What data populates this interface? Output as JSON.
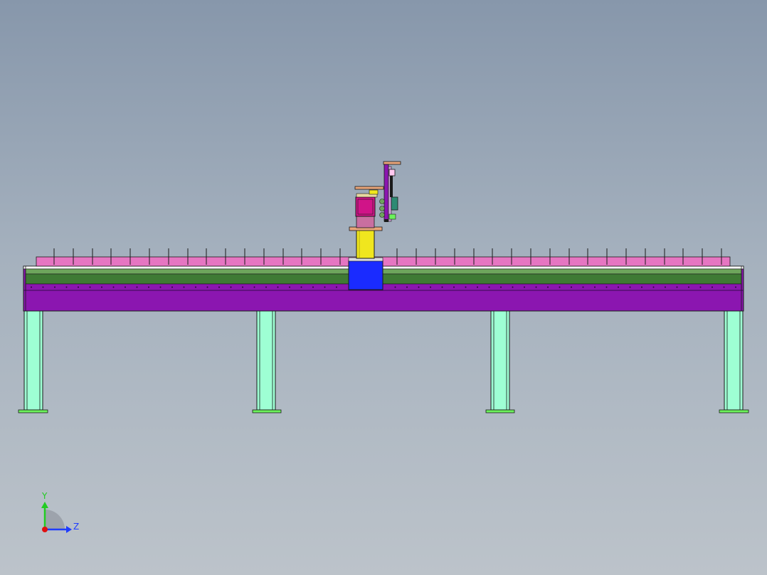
{
  "triad": {
    "y_label": "Y",
    "z_label": "Z",
    "colors": {
      "y_axis": "#22cc22",
      "z_axis": "#1e3cff",
      "x_axis": "#e01010"
    }
  },
  "model": {
    "colors": {
      "beam": "#8b16b0",
      "beam_dark": "#5a0a78",
      "rail": "#3f7a34",
      "rail_light": "#6ea55c",
      "rack": "#e676c2",
      "leg": "#9effd4",
      "foot": "#6cf25c",
      "carriage": "#1a2bff",
      "column": "#f0e61e",
      "motor_box": "#d01488",
      "arm_plate": "#e8a57a",
      "vertical_slide": "#8b16b0",
      "gripper": "#2e8b74"
    },
    "rack_tooth_count": 36,
    "leg_count": 4
  }
}
